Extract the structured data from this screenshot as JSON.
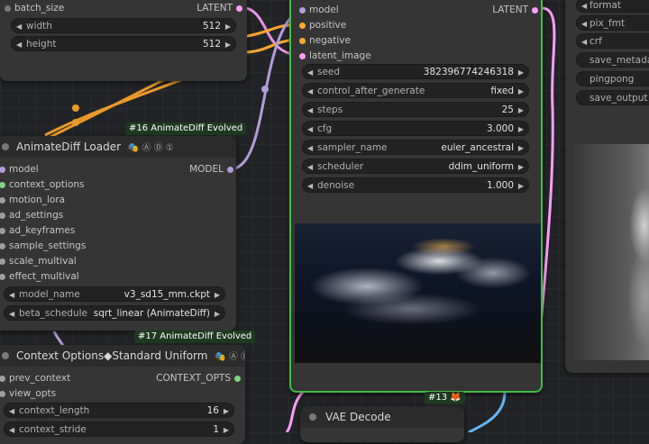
{
  "top_left_node": {
    "batch_size": {
      "label": "batch_size",
      "output": "LATENT"
    },
    "widgets": [
      {
        "label": "width",
        "value": "512"
      },
      {
        "label": "height",
        "value": "512"
      }
    ]
  },
  "sampler_node": {
    "inputs": [
      "model",
      "positive",
      "negative",
      "latent_image"
    ],
    "output": "LATENT",
    "widgets": [
      {
        "label": "seed",
        "value": "382396774246318"
      },
      {
        "label": "control_after_generate",
        "value": "fixed"
      },
      {
        "label": "steps",
        "value": "25"
      },
      {
        "label": "cfg",
        "value": "3.000"
      },
      {
        "label": "sampler_name",
        "value": "euler_ancestral"
      },
      {
        "label": "scheduler",
        "value": "ddim_uniform"
      },
      {
        "label": "denoise",
        "value": "1.000"
      }
    ],
    "badge": "#13 🦊"
  },
  "animatediff_loader": {
    "badge": "#16 AnimateDiff Evolved",
    "title": "AnimateDiff Loader",
    "title_icons": "🎭 Ⓐ Ⓓ ①",
    "inputs": [
      "model",
      "context_options",
      "motion_lora",
      "ad_settings",
      "ad_keyframes",
      "sample_settings",
      "scale_multival",
      "effect_multival"
    ],
    "output": "MODEL",
    "widgets": [
      {
        "label": "model_name",
        "value": "v3_sd15_mm.ckpt"
      },
      {
        "label": "beta_schedule",
        "value": "sqrt_linear (AnimateDiff)"
      }
    ]
  },
  "context_options": {
    "badge": "#17 AnimateDiff Evolved",
    "title": "Context Options◆Standard Uniform",
    "title_icons": "🎭 Ⓐ Ⓓ",
    "inputs": [
      "prev_context",
      "view_opts"
    ],
    "output": "CONTEXT_OPTS",
    "widgets": [
      {
        "label": "context_length",
        "value": "16"
      },
      {
        "label": "context_stride",
        "value": "1"
      }
    ]
  },
  "vae_decode": {
    "title": "VAE Decode"
  },
  "video_combine": {
    "widgets": [
      "format",
      "pix_fmt",
      "crf",
      "save_metadata",
      "pingpong",
      "save_output"
    ]
  },
  "colors": {
    "latent": "#ff9cf9",
    "model": "#b39ddb",
    "conditioning": "#ffa931",
    "context": "#7fd27f",
    "node_bg": "#353535"
  }
}
